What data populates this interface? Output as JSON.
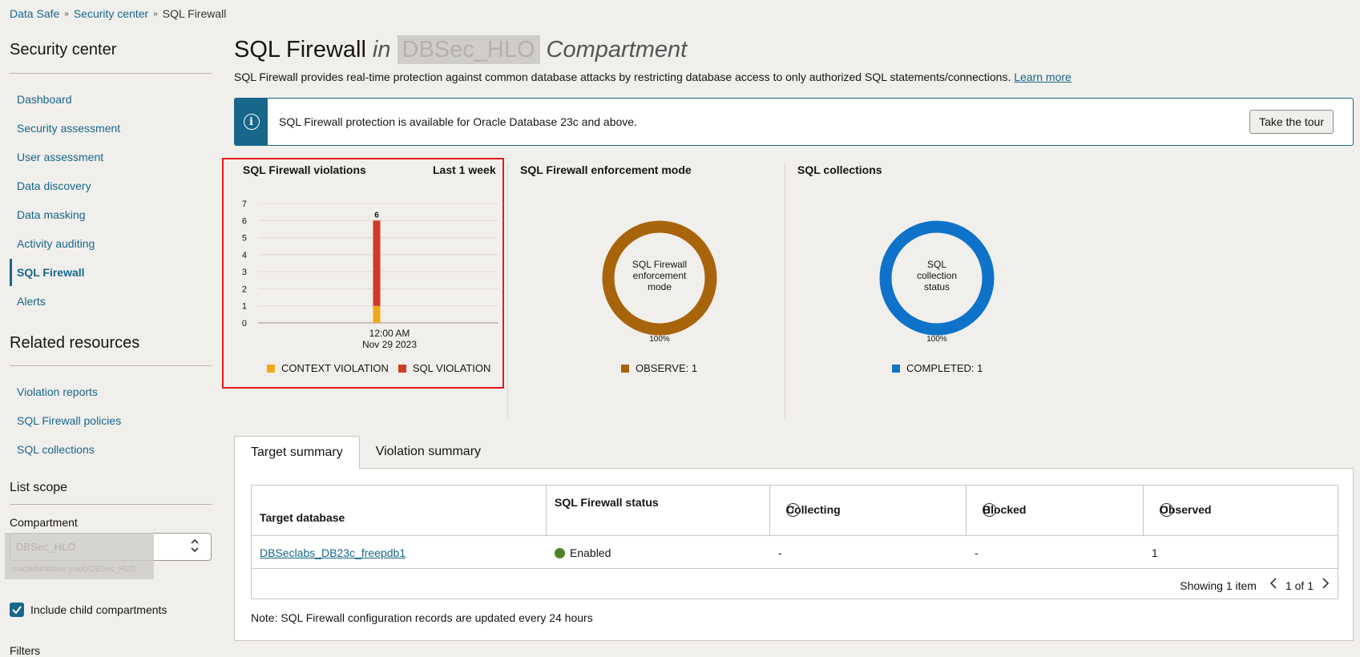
{
  "breadcrumb": {
    "item1": "Data Safe",
    "item2": "Security center",
    "current": "SQL Firewall",
    "sep": "»"
  },
  "sidebar": {
    "heading": "Security center",
    "items": [
      {
        "label": "Dashboard"
      },
      {
        "label": "Security assessment"
      },
      {
        "label": "User assessment"
      },
      {
        "label": "Data discovery"
      },
      {
        "label": "Data masking"
      },
      {
        "label": "Activity auditing"
      },
      {
        "label": "SQL Firewall",
        "active": true
      },
      {
        "label": "Alerts"
      }
    ],
    "related_heading": "Related resources",
    "related_items": [
      {
        "label": "Violation reports"
      },
      {
        "label": "SQL Firewall policies"
      },
      {
        "label": "SQL collections"
      }
    ],
    "scope_heading": "List scope",
    "compartment_label": "Compartment",
    "compartment_value": "DBSec_HLO",
    "compartment_path": "oracledatabase (root)/DBSec_HLO",
    "include_child_label": "Include child compartments",
    "include_child_checked": true,
    "filters_heading": "Filters"
  },
  "header": {
    "title": "SQL Firewall",
    "in": "in",
    "compartment": "DBSec_HLO",
    "compartment_suffix": "Compartment",
    "description": "SQL Firewall provides real-time protection against common database attacks by restricting database access to only authorized SQL statements/connections.",
    "learn_more": "Learn more"
  },
  "banner": {
    "text": "SQL Firewall protection is available for Oracle Database 23c and above.",
    "tour_button": "Take the tour",
    "info_glyph": "i"
  },
  "violations_card": {
    "title": "SQL Firewall violations",
    "range": "Last 1 week",
    "chart_data": {
      "type": "bar",
      "stacked": true,
      "categories": [
        "12:00 AM\nNov 29 2023"
      ],
      "category_line1": "12:00 AM",
      "category_line2": "Nov 29 2023",
      "series": [
        {
          "name": "CONTEXT VIOLATION",
          "values": [
            1
          ],
          "color": "#f0a81a"
        },
        {
          "name": "SQL VIOLATION",
          "values": [
            5
          ],
          "color": "#d03a27"
        }
      ],
      "total_label": "6",
      "ylim": [
        0,
        7
      ],
      "yticks": [
        "0",
        "1",
        "2",
        "3",
        "4",
        "5",
        "6",
        "7"
      ],
      "grid": true,
      "legend_position": "bottom"
    }
  },
  "enforcement_card": {
    "title": "SQL Firewall enforcement mode",
    "center_line1": "SQL Firewall",
    "center_line2": "enforcement",
    "center_line3": "mode",
    "chart_data": {
      "type": "pie",
      "donut": true,
      "slices": [
        {
          "label": "OBSERVE",
          "value": 1,
          "percent": 100,
          "color": "#a8640b"
        }
      ]
    },
    "pct_label": "100%",
    "legend": "OBSERVE: 1"
  },
  "collections_card": {
    "title": "SQL collections",
    "center_line1": "SQL",
    "center_line2": "collection",
    "center_line3": "status",
    "chart_data": {
      "type": "pie",
      "donut": true,
      "slices": [
        {
          "label": "COMPLETED",
          "value": 1,
          "percent": 100,
          "color": "#0e72c9"
        }
      ]
    },
    "pct_label": "100%",
    "legend": "COMPLETED: 1"
  },
  "tabs": [
    {
      "label": "Target summary",
      "active": true
    },
    {
      "label": "Violation summary",
      "active": false
    }
  ],
  "table": {
    "columns": [
      "Target database",
      "SQL Firewall status",
      "Collecting",
      "Blocked",
      "Observed"
    ],
    "rows": [
      {
        "target": "DBSeclabs_DB23c_freepdb1",
        "status": "Enabled",
        "collecting": "-",
        "blocked": "-",
        "observed": "1"
      }
    ],
    "showing": "Showing 1 item",
    "page": "1 of 1",
    "info_glyph": "i"
  },
  "note": "Note: SQL Firewall configuration records are updated every 24 hours",
  "colors": {
    "accent": "#16678a",
    "enabled": "#508223",
    "highlight": "#e21b1b"
  }
}
